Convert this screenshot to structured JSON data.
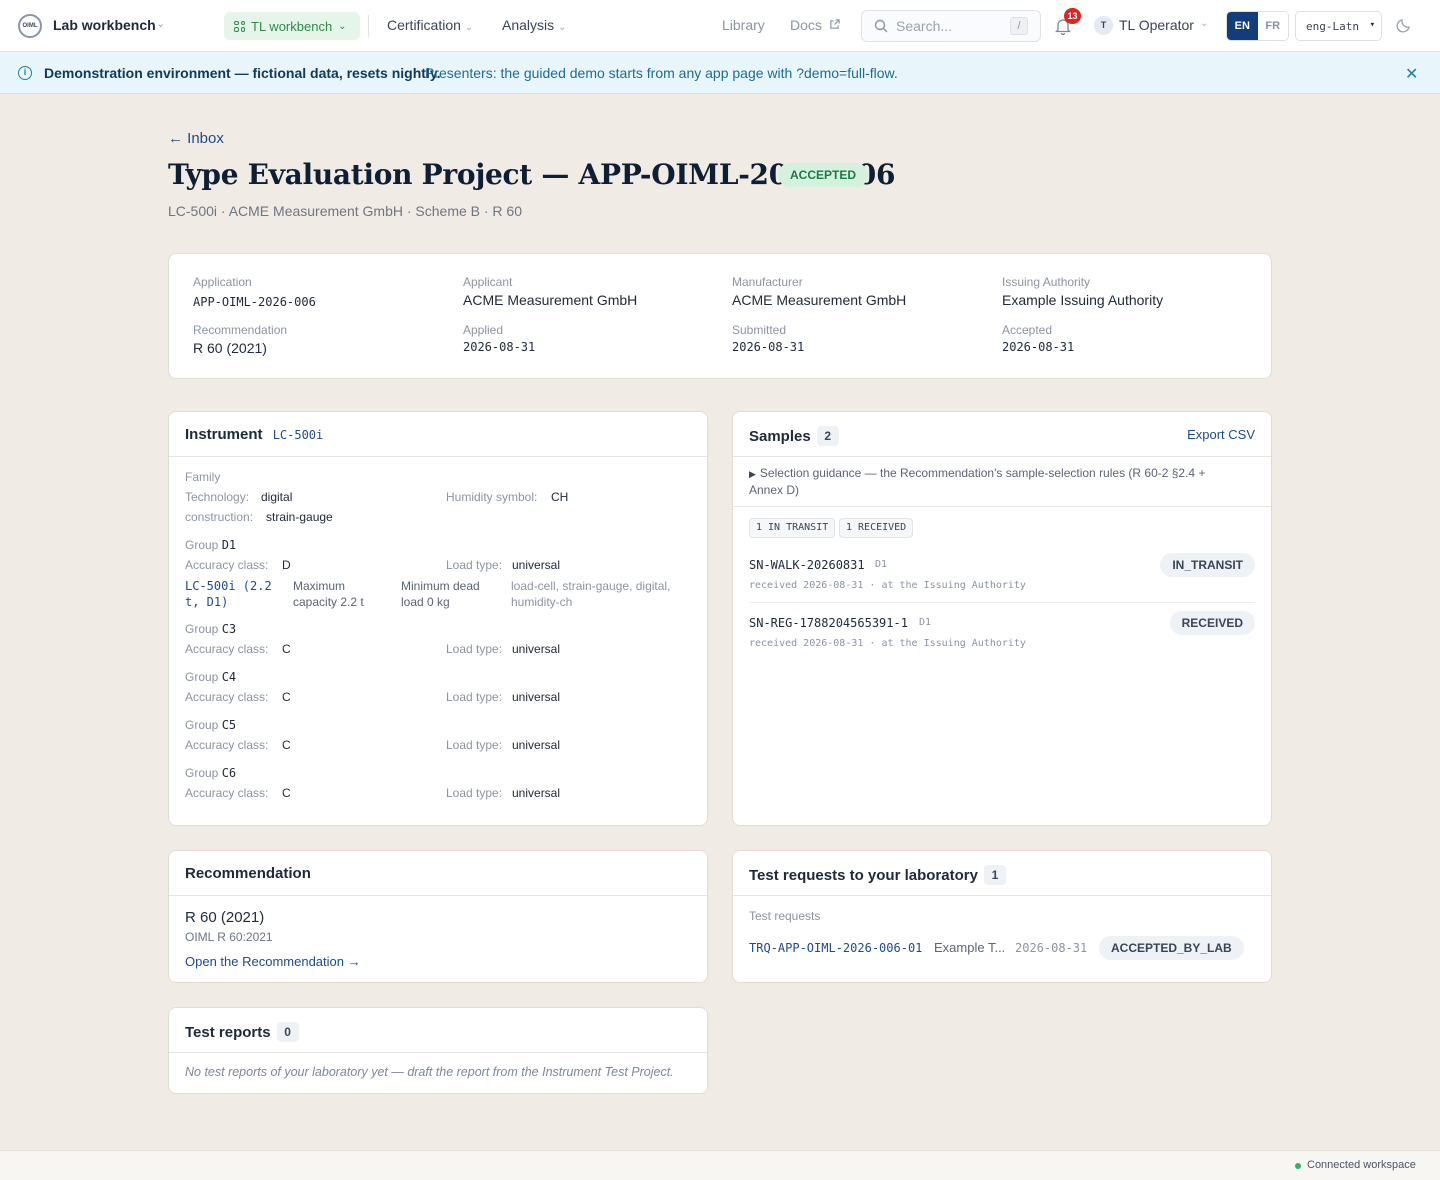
{
  "topbar": {
    "logo_text": "OIML",
    "app_name": "Lab workbench",
    "workspace": "TL workbench",
    "nav": [
      "Certification",
      "Analysis"
    ],
    "library": "Library",
    "docs": "Docs",
    "search_placeholder": "Search...",
    "search_shortcut": "/",
    "notification_count": "13",
    "user_initial": "T",
    "user_name": "TL Operator",
    "lang_en": "EN",
    "lang_fr": "FR",
    "script": "eng-Latn"
  },
  "banner": {
    "strong": "Demonstration environment — fictional data, resets nightly.",
    "message": "Presenters: the guided demo starts from any app page with ?demo=full-flow."
  },
  "header": {
    "back": "← Inbox",
    "title": "Type Evaluation Project — APP-OIML-2026-006",
    "status": "ACCEPTED",
    "subtitle": "LC-500i · ACME Measurement GmbH · Scheme B · R 60"
  },
  "summary": {
    "application_label": "Application",
    "application": "APP-OIML-2026-006",
    "applicant_label": "Applicant",
    "applicant": "ACME Measurement GmbH",
    "manufacturer_label": "Manufacturer",
    "manufacturer": "ACME Measurement GmbH",
    "authority_label": "Issuing Authority",
    "authority": "Example Issuing Authority",
    "recommendation_label": "Recommendation",
    "recommendation": "R 60 (2021)",
    "applied_label": "Applied",
    "applied": "2026-08-31",
    "submitted_label": "Submitted",
    "submitted": "2026-08-31",
    "accepted_label": "Accepted",
    "accepted": "2026-08-31"
  },
  "instrument": {
    "title": "Instrument",
    "model": "LC-500i",
    "family_label": "Family",
    "technology_label": "Technology:",
    "technology": "digital",
    "humidity_label": "Humidity symbol:",
    "humidity": "CH",
    "construction_label": "construction:",
    "construction": "strain-gauge",
    "group_label": "Group",
    "accuracy_label": "Accuracy class:",
    "load_label": "Load type:",
    "groups": [
      {
        "id": "D1",
        "accuracy": "D",
        "load": "universal"
      },
      {
        "id": "C3",
        "accuracy": "C",
        "load": "universal"
      },
      {
        "id": "C4",
        "accuracy": "C",
        "load": "universal"
      },
      {
        "id": "C5",
        "accuracy": "C",
        "load": "universal"
      },
      {
        "id": "C6",
        "accuracy": "C",
        "load": "universal"
      }
    ],
    "variant": {
      "name_line1": "LC-500i (2.2",
      "name_line2": "t, D1)",
      "max_line1": "Maximum",
      "max_line2": "capacity 2.2 t",
      "min_line1": "Minimum dead",
      "min_line2": "load 0 kg",
      "tags_line1": "load-cell, strain-gauge, digital,",
      "tags_line2": "humidity-ch"
    }
  },
  "samples": {
    "title": "Samples",
    "count": "2",
    "export": "Export CSV",
    "guidance_line1": "Selection guidance — the Recommendation's sample-selection rules (R 60-2 §2.4 +",
    "guidance_line2": "Annex D)",
    "chip_transit": "1 IN TRANSIT",
    "chip_received": "1 RECEIVED",
    "items": [
      {
        "id": "SN-WALK-20260831",
        "group": "D1",
        "meta": "received 2026-08-31 · at the Issuing Authority",
        "state": "IN_TRANSIT"
      },
      {
        "id": "SN-REG-1788204565391-1",
        "group": "D1",
        "meta": "received 2026-08-31 · at the Issuing Authority",
        "state": "RECEIVED"
      }
    ]
  },
  "recommendation": {
    "title": "Recommendation",
    "name": "R 60 (2021)",
    "code": "OIML R 60:2021",
    "link": "Open the Recommendation →"
  },
  "test_requests": {
    "title": "Test requests to your laboratory",
    "count": "1",
    "label": "Test requests",
    "id": "TRQ-APP-OIML-2026-006-01",
    "lab": "Example T...",
    "date": "2026-08-31",
    "state": "ACCEPTED_BY_LAB"
  },
  "test_reports": {
    "title": "Test reports",
    "count": "0",
    "empty": "No test reports of your laboratory yet — draft the report from the Instrument Test Project."
  },
  "footer": {
    "status": "Connected workspace"
  }
}
